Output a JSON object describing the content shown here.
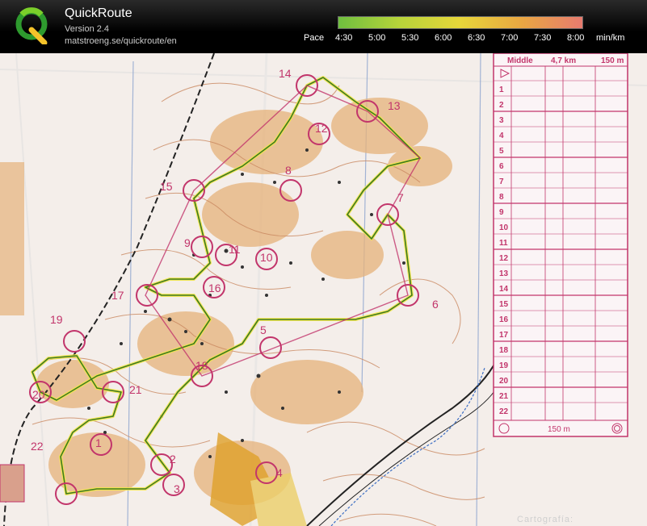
{
  "app": {
    "title": "QuickRoute",
    "version": "Version 2.4",
    "url": "matstroeng.se/quickroute/en"
  },
  "pace_scale": {
    "label": "Pace",
    "ticks": [
      "4:30",
      "5:00",
      "5:30",
      "6:00",
      "6:30",
      "7:00",
      "7:30",
      "8:00"
    ],
    "unit": "min/km",
    "colors": [
      "#6fbf3f",
      "#b7d43a",
      "#e7d63a",
      "#e9a742",
      "#e77b6f"
    ]
  },
  "map": {
    "colors": {
      "paper": "#f4eeea",
      "contour": "#c9875f",
      "rough": "#e6b27a",
      "control": "#c2356b",
      "route": "#3f7a1f",
      "route_glow": "#f2e54a"
    },
    "control_labels": [
      "14",
      "13",
      "12",
      "15",
      "7",
      "9",
      "10",
      "11",
      "17",
      "8",
      "16",
      "6",
      "19",
      "5",
      "18",
      "20",
      "21",
      "22",
      "1",
      "2",
      "3",
      "4"
    ],
    "credit": "Cartografía:"
  },
  "description_sheet": {
    "class_name": "Middle",
    "length": "4,7 km",
    "climb": "150 m",
    "rows": [
      "1",
      "2",
      "3",
      "4",
      "5",
      "6",
      "7",
      "8",
      "9",
      "10",
      "11",
      "12",
      "13",
      "14",
      "15",
      "16",
      "17",
      "18",
      "19",
      "20",
      "21",
      "22"
    ],
    "finish_distance": "150 m"
  }
}
